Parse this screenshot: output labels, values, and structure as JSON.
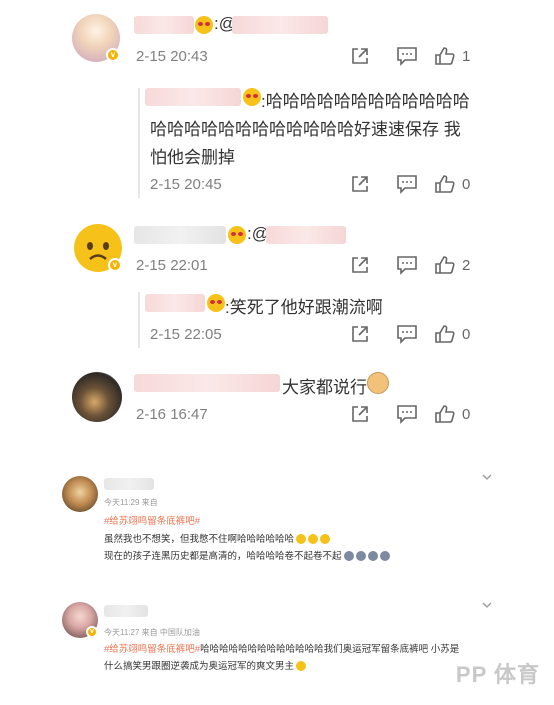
{
  "comments": [
    {
      "reply_prefix": ":@",
      "time": "2-15 20:43",
      "likes": "1"
    },
    {
      "text_line1": ":哈哈哈哈哈哈哈哈哈哈哈哈",
      "text_line2": "哈哈哈哈哈哈哈哈哈哈哈哈好速速保存 我",
      "text_line3": "怕他会删掉",
      "time": "2-15 20:45",
      "likes": "0"
    },
    {
      "reply_prefix": ":@",
      "time": "2-15 22:01",
      "likes": "2"
    },
    {
      "text": ":笑死了他好跟潮流啊",
      "time": "2-15 22:05",
      "likes": "0"
    },
    {
      "text": "大家都说行",
      "time": "2-16 16:47",
      "likes": "0"
    }
  ],
  "weibo_posts": [
    {
      "meta": "今天11:29  来自",
      "tag": "#给苏翊鸣留条底裤吧#",
      "line1": "虽然我也不想笑，但我憋不住啊哈哈哈哈哈哈",
      "line2": "现在的孩子连黑历史都是高清的，哈哈哈哈卷不起卷不起"
    },
    {
      "meta": "今天11:27  来自 中国队加油",
      "tag": "#给苏翊鸣留条底裤吧#",
      "line1_rest": "哈哈哈哈哈哈哈哈哈哈哈哈哈我们奥运冠军留条底裤吧 小苏是",
      "line2": "什么搞笑男跟圈逆袭成为奥运冠军的爽文男主"
    }
  ],
  "watermark": "PP 体育",
  "icons": [
    "repost-icon",
    "comment-icon",
    "like-icon",
    "chevron-down-icon"
  ]
}
